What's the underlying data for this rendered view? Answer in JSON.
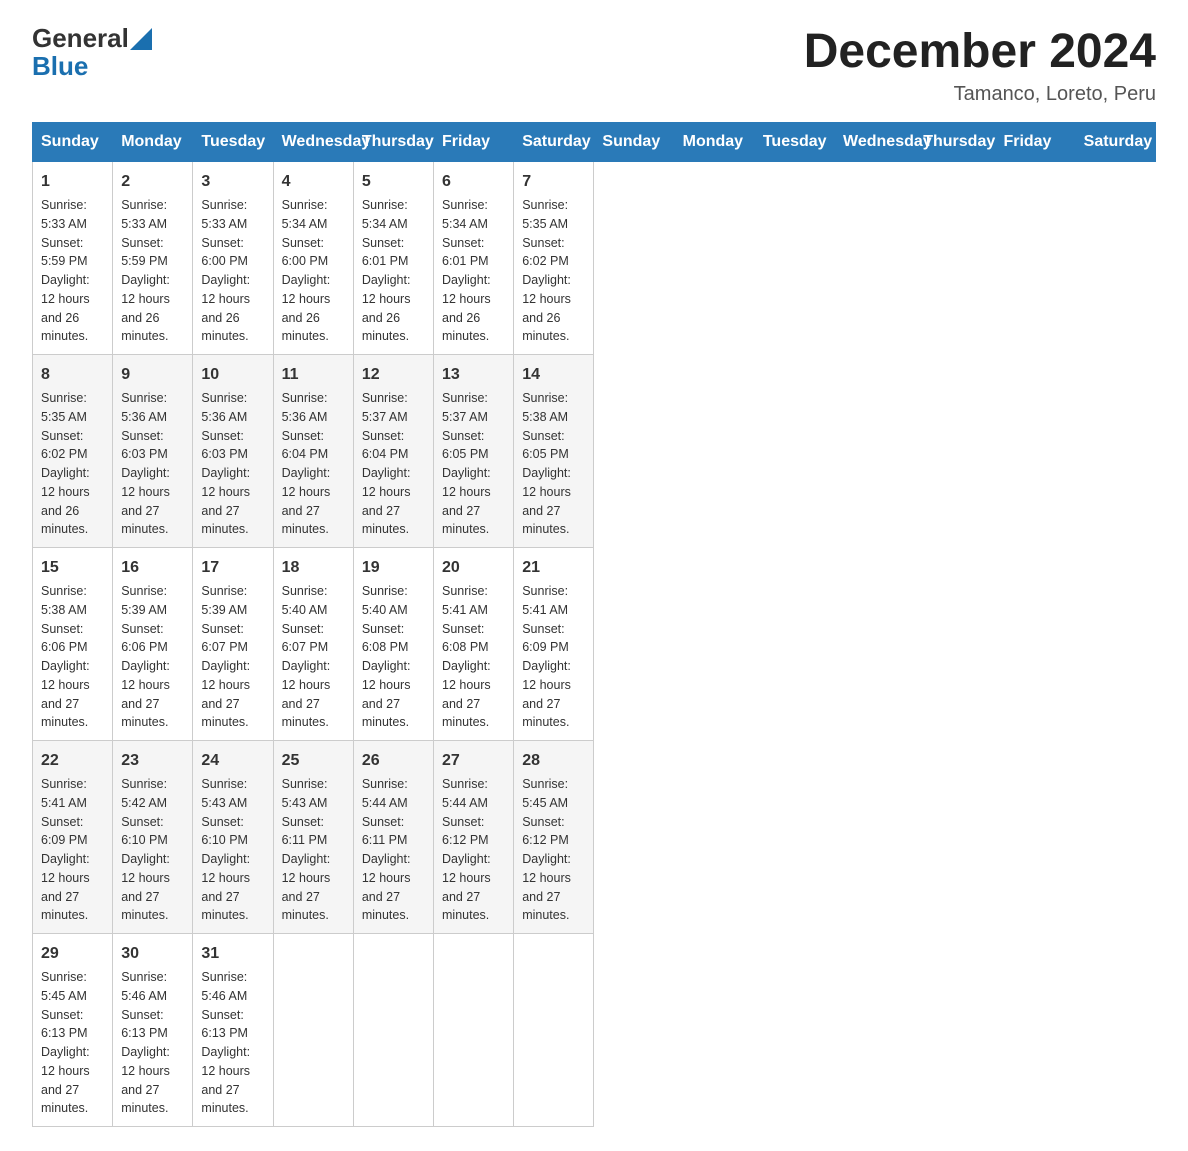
{
  "logo": {
    "text_general": "General",
    "text_blue": "Blue"
  },
  "header": {
    "title": "December 2024",
    "subtitle": "Tamanco, Loreto, Peru"
  },
  "days_of_week": [
    "Sunday",
    "Monday",
    "Tuesday",
    "Wednesday",
    "Thursday",
    "Friday",
    "Saturday"
  ],
  "weeks": [
    [
      {
        "day": "1",
        "sunrise": "5:33 AM",
        "sunset": "5:59 PM",
        "daylight": "12 hours and 26 minutes."
      },
      {
        "day": "2",
        "sunrise": "5:33 AM",
        "sunset": "5:59 PM",
        "daylight": "12 hours and 26 minutes."
      },
      {
        "day": "3",
        "sunrise": "5:33 AM",
        "sunset": "6:00 PM",
        "daylight": "12 hours and 26 minutes."
      },
      {
        "day": "4",
        "sunrise": "5:34 AM",
        "sunset": "6:00 PM",
        "daylight": "12 hours and 26 minutes."
      },
      {
        "day": "5",
        "sunrise": "5:34 AM",
        "sunset": "6:01 PM",
        "daylight": "12 hours and 26 minutes."
      },
      {
        "day": "6",
        "sunrise": "5:34 AM",
        "sunset": "6:01 PM",
        "daylight": "12 hours and 26 minutes."
      },
      {
        "day": "7",
        "sunrise": "5:35 AM",
        "sunset": "6:02 PM",
        "daylight": "12 hours and 26 minutes."
      }
    ],
    [
      {
        "day": "8",
        "sunrise": "5:35 AM",
        "sunset": "6:02 PM",
        "daylight": "12 hours and 26 minutes."
      },
      {
        "day": "9",
        "sunrise": "5:36 AM",
        "sunset": "6:03 PM",
        "daylight": "12 hours and 27 minutes."
      },
      {
        "day": "10",
        "sunrise": "5:36 AM",
        "sunset": "6:03 PM",
        "daylight": "12 hours and 27 minutes."
      },
      {
        "day": "11",
        "sunrise": "5:36 AM",
        "sunset": "6:04 PM",
        "daylight": "12 hours and 27 minutes."
      },
      {
        "day": "12",
        "sunrise": "5:37 AM",
        "sunset": "6:04 PM",
        "daylight": "12 hours and 27 minutes."
      },
      {
        "day": "13",
        "sunrise": "5:37 AM",
        "sunset": "6:05 PM",
        "daylight": "12 hours and 27 minutes."
      },
      {
        "day": "14",
        "sunrise": "5:38 AM",
        "sunset": "6:05 PM",
        "daylight": "12 hours and 27 minutes."
      }
    ],
    [
      {
        "day": "15",
        "sunrise": "5:38 AM",
        "sunset": "6:06 PM",
        "daylight": "12 hours and 27 minutes."
      },
      {
        "day": "16",
        "sunrise": "5:39 AM",
        "sunset": "6:06 PM",
        "daylight": "12 hours and 27 minutes."
      },
      {
        "day": "17",
        "sunrise": "5:39 AM",
        "sunset": "6:07 PM",
        "daylight": "12 hours and 27 minutes."
      },
      {
        "day": "18",
        "sunrise": "5:40 AM",
        "sunset": "6:07 PM",
        "daylight": "12 hours and 27 minutes."
      },
      {
        "day": "19",
        "sunrise": "5:40 AM",
        "sunset": "6:08 PM",
        "daylight": "12 hours and 27 minutes."
      },
      {
        "day": "20",
        "sunrise": "5:41 AM",
        "sunset": "6:08 PM",
        "daylight": "12 hours and 27 minutes."
      },
      {
        "day": "21",
        "sunrise": "5:41 AM",
        "sunset": "6:09 PM",
        "daylight": "12 hours and 27 minutes."
      }
    ],
    [
      {
        "day": "22",
        "sunrise": "5:41 AM",
        "sunset": "6:09 PM",
        "daylight": "12 hours and 27 minutes."
      },
      {
        "day": "23",
        "sunrise": "5:42 AM",
        "sunset": "6:10 PM",
        "daylight": "12 hours and 27 minutes."
      },
      {
        "day": "24",
        "sunrise": "5:43 AM",
        "sunset": "6:10 PM",
        "daylight": "12 hours and 27 minutes."
      },
      {
        "day": "25",
        "sunrise": "5:43 AM",
        "sunset": "6:11 PM",
        "daylight": "12 hours and 27 minutes."
      },
      {
        "day": "26",
        "sunrise": "5:44 AM",
        "sunset": "6:11 PM",
        "daylight": "12 hours and 27 minutes."
      },
      {
        "day": "27",
        "sunrise": "5:44 AM",
        "sunset": "6:12 PM",
        "daylight": "12 hours and 27 minutes."
      },
      {
        "day": "28",
        "sunrise": "5:45 AM",
        "sunset": "6:12 PM",
        "daylight": "12 hours and 27 minutes."
      }
    ],
    [
      {
        "day": "29",
        "sunrise": "5:45 AM",
        "sunset": "6:13 PM",
        "daylight": "12 hours and 27 minutes."
      },
      {
        "day": "30",
        "sunrise": "5:46 AM",
        "sunset": "6:13 PM",
        "daylight": "12 hours and 27 minutes."
      },
      {
        "day": "31",
        "sunrise": "5:46 AM",
        "sunset": "6:13 PM",
        "daylight": "12 hours and 27 minutes."
      },
      null,
      null,
      null,
      null
    ]
  ],
  "labels": {
    "sunrise": "Sunrise:",
    "sunset": "Sunset:",
    "daylight": "Daylight:"
  }
}
